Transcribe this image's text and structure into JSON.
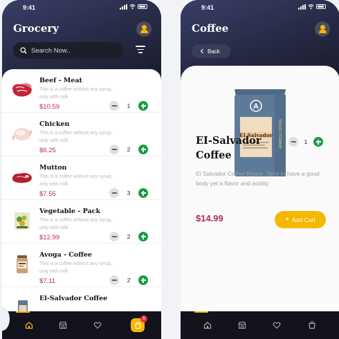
{
  "status": {
    "time": "9:41"
  },
  "list_screen": {
    "title": "Grocery",
    "search_placeholder": "Search Now..",
    "items": [
      {
        "name": "Beef - Meat",
        "desc": "This is a coffee without any syrup, only with milk",
        "price": "$10.59",
        "qty": "1"
      },
      {
        "name": "Chicken",
        "desc": "This is a coffee without any syrup, only with milk",
        "price": "$6.25",
        "qty": "2"
      },
      {
        "name": "Mutton",
        "desc": "This is a coffee without any syrup, only with milk",
        "price": "$7.55",
        "qty": "3"
      },
      {
        "name": "Vegetable - Pack",
        "desc": "This is a coffee without any syrup, only with milk",
        "price": "$12.99",
        "qty": "2"
      },
      {
        "name": "Avoga - Coffee",
        "desc": "This is a coffee without any syrup, only with milk",
        "price": "$7.11",
        "qty": "2"
      },
      {
        "name": "El-Salvador Coffee"
      }
    ],
    "cart_badge": "5"
  },
  "detail_screen": {
    "title": "Coffee",
    "back_label": "Back",
    "product_name": "EI-Salvador Coffee",
    "description": "El Salvador Coffee Beans. Tend to have a good body yet a  flavor and acidity.",
    "qty": "1",
    "price": "$14.99",
    "add_cart_label": "Add Cart",
    "bag_label": "El Salvador",
    "bag_logo": "A",
    "bag_side_text": "ARABICA COFFEE"
  },
  "colors": {
    "accent": "#f5b800",
    "price": "#b22a60",
    "plus": "#1a9c46",
    "dark": "#12131c"
  },
  "icons": [
    "search-icon",
    "filter-icon",
    "user-icon",
    "home-icon",
    "store-icon",
    "heart-icon",
    "cart-icon",
    "plus-icon",
    "minus-icon",
    "back-chevron-icon"
  ]
}
